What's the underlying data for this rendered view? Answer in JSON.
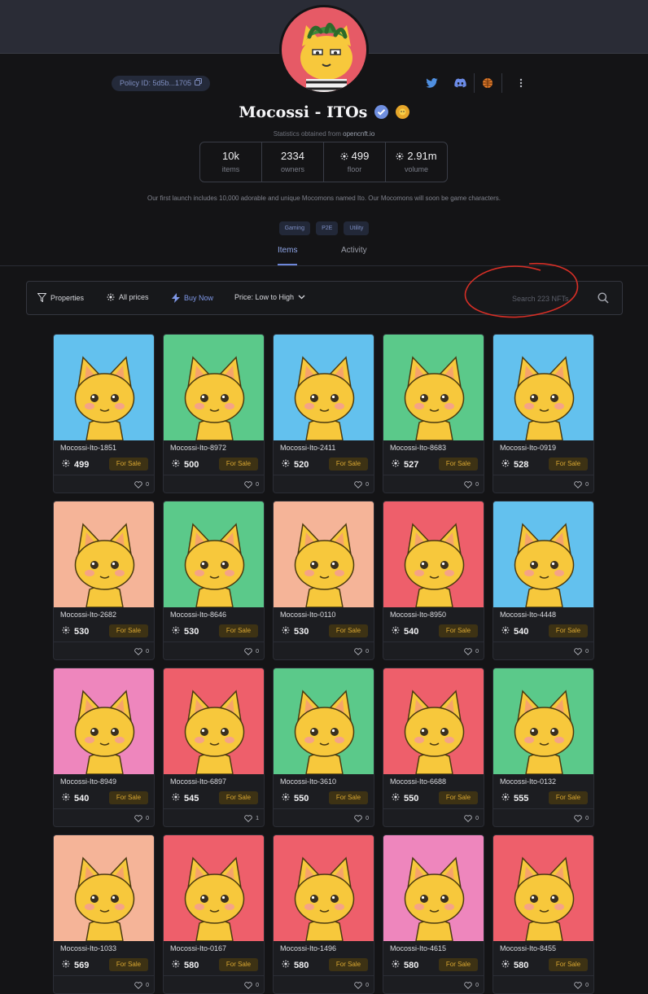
{
  "header": {
    "policy_id": "Policy ID: 5d5b...1705",
    "title": "Mocossi - ITOs",
    "stats_note_prefix": "Statistics obtained from",
    "stats_note_source": "opencnft.io",
    "description": "Our first launch includes 10,000 adorable and unique Mocomons named Ito. Our Mocomons will soon be game characters."
  },
  "stats": [
    {
      "value": "10k",
      "label": "items"
    },
    {
      "value": "2334",
      "label": "owners"
    },
    {
      "value": "499",
      "label": "floor"
    },
    {
      "value": "2.91m",
      "label": "volume"
    }
  ],
  "tags": [
    "Gaming",
    "P2E",
    "Utility"
  ],
  "tabs": [
    "Items",
    "Activity"
  ],
  "filters": {
    "properties": "Properties",
    "all_prices": "All prices",
    "buy_now": "Buy Now",
    "sort": "Price: Low to High",
    "search_placeholder": "Search 223 NFTs"
  },
  "colors": {
    "accent": "#7f98e8",
    "for_sale_bg": "#3d3214",
    "for_sale_text": "#d9a732",
    "annotation": "#d62f26"
  },
  "sale_label": "For Sale",
  "items": [
    {
      "name": "Mocossi-Ito-1851",
      "price": "499",
      "likes": "0",
      "bg": "#63c1ee"
    },
    {
      "name": "Mocossi-Ito-8972",
      "price": "500",
      "likes": "0",
      "bg": "#5bc98a"
    },
    {
      "name": "Mocossi-Ito-2411",
      "price": "520",
      "likes": "0",
      "bg": "#63c1ee"
    },
    {
      "name": "Mocossi-Ito-8683",
      "price": "527",
      "likes": "0",
      "bg": "#5bc98a"
    },
    {
      "name": "Mocossi-Ito-0919",
      "price": "528",
      "likes": "0",
      "bg": "#63c1ee"
    },
    {
      "name": "Mocossi-Ito-2682",
      "price": "530",
      "likes": "0",
      "bg": "#f5b498"
    },
    {
      "name": "Mocossi-Ito-8646",
      "price": "530",
      "likes": "0",
      "bg": "#5bc98a"
    },
    {
      "name": "Mocossi-Ito-0110",
      "price": "530",
      "likes": "0",
      "bg": "#f5b498"
    },
    {
      "name": "Mocossi-Ito-8950",
      "price": "540",
      "likes": "0",
      "bg": "#ee5f6b"
    },
    {
      "name": "Mocossi-Ito-4448",
      "price": "540",
      "likes": "0",
      "bg": "#63c1ee"
    },
    {
      "name": "Mocossi-Ito-8949",
      "price": "540",
      "likes": "0",
      "bg": "#ee86bd"
    },
    {
      "name": "Mocossi-Ito-6897",
      "price": "545",
      "likes": "1",
      "bg": "#ee5f6b"
    },
    {
      "name": "Mocossi-Ito-3610",
      "price": "550",
      "likes": "0",
      "bg": "#5bc98a"
    },
    {
      "name": "Mocossi-Ito-6688",
      "price": "550",
      "likes": "0",
      "bg": "#ee5f6b"
    },
    {
      "name": "Mocossi-Ito-0132",
      "price": "555",
      "likes": "0",
      "bg": "#5bc98a"
    },
    {
      "name": "Mocossi-Ito-1033",
      "price": "569",
      "likes": "0",
      "bg": "#f5b498"
    },
    {
      "name": "Mocossi-Ito-0167",
      "price": "580",
      "likes": "0",
      "bg": "#ee5f6b"
    },
    {
      "name": "Mocossi-Ito-1496",
      "price": "580",
      "likes": "0",
      "bg": "#ee5f6b"
    },
    {
      "name": "Mocossi-Ito-4615",
      "price": "580",
      "likes": "0",
      "bg": "#ee86bd"
    },
    {
      "name": "Mocossi-Ito-8455",
      "price": "580",
      "likes": "0",
      "bg": "#ee5f6b"
    }
  ]
}
